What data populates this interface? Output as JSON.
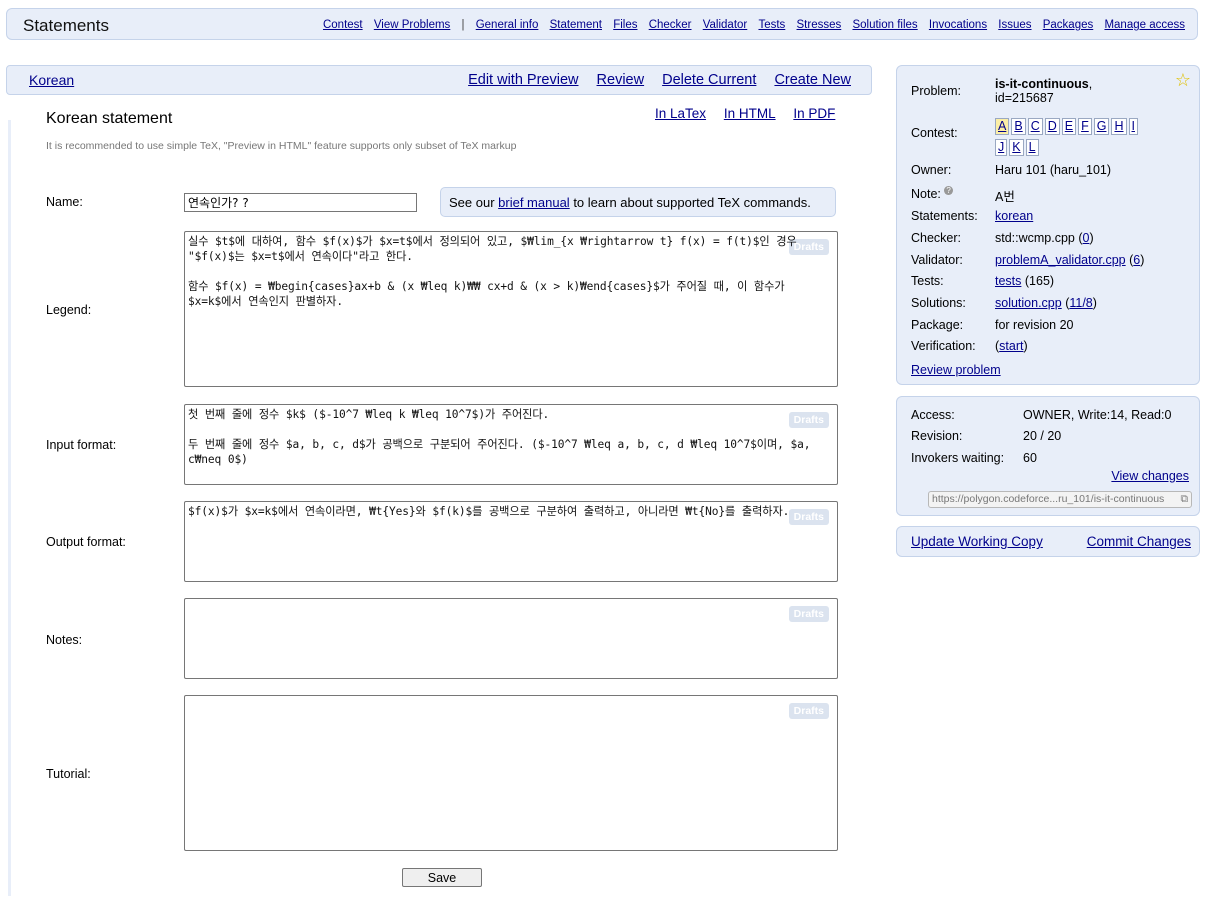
{
  "header": {
    "title": "Statements",
    "menu_left": [
      "Contest",
      "View Problems"
    ],
    "menu_sep": "|",
    "menu_right": [
      "General info",
      "Statement",
      "Files",
      "Checker",
      "Validator",
      "Tests",
      "Stresses",
      "Solution files",
      "Invocations",
      "Issues",
      "Packages",
      "Manage access"
    ]
  },
  "subbar": {
    "language": "Korean",
    "actions": [
      "Edit with Preview",
      "Review",
      "Delete Current",
      "Create New"
    ]
  },
  "statement": {
    "title": "Korean statement",
    "formats": [
      "In LaTex",
      "In HTML",
      "In PDF"
    ],
    "hint": "It is recommended to use simple TeX, \"Preview in HTML\" feature supports only subset of TeX markup",
    "name_label": "Name:",
    "name_value": "연속인가? ?",
    "notice_pre": "See our ",
    "notice_link": "brief manual",
    "notice_post": " to learn about supported TeX commands.",
    "drafts_label": "Drafts",
    "fields": {
      "legend": {
        "label": "Legend:",
        "value": "실수 $t$에 대하여, 함수 $f(x)$가 $x=t$에서 정의되어 있고, $₩lim_{x ₩rightarrow t} f(x) = f(t)$인 경우 \"$f(x)$는 $x=t$에서 연속이다\"라고 한다.\n\n함수 $f(x) = ₩begin{cases}ax+b & (x ₩leq k)₩₩ cx+d & (x > k)₩end{cases}$가 주어질 때, 이 함수가 $x=k$에서 연속인지 판별하자."
      },
      "input": {
        "label": "Input format:",
        "value": "첫 번째 줄에 정수 $k$ ($-10^7 ₩leq k ₩leq 10^7$)가 주어진다.\n\n두 번째 줄에 정수 $a, b, c, d$가 공백으로 구분되어 주어진다. ($-10^7 ₩leq a, b, c, d ₩leq 10^7$이며, $a, c₩neq 0$)"
      },
      "output": {
        "label": "Output format:",
        "value": "$f(x)$가 $x=k$에서 연속이라면, ₩t{Yes}와 $f(k)$를 공백으로 구분하여 출력하고, 아니라면 ₩t{No}를 출력하자."
      },
      "notes": {
        "label": "Notes:",
        "value": ""
      },
      "tutorial": {
        "label": "Tutorial:",
        "value": ""
      }
    },
    "save_label": "Save"
  },
  "problem_info": {
    "problem_label": "Problem:",
    "problem_name": "is-it-continuous",
    "problem_comma": ",",
    "problem_id": "id=215687",
    "contest_label": "Contest:",
    "contest_letters": [
      "A",
      "B",
      "C",
      "D",
      "E",
      "F",
      "G",
      "H",
      "I",
      "J",
      "K",
      "L"
    ],
    "active_letter": "A",
    "owner_label": "Owner:",
    "owner_value": "Haru 101 (haru_101)",
    "note_label": "Note:",
    "note_help": "?",
    "note_value": "A번",
    "statements_label": "Statements:",
    "statements_value": "korean",
    "checker_label": "Checker:",
    "checker_value": "std::wcmp.cpp",
    "checker_count": "0",
    "validator_label": "Validator:",
    "validator_value": "problemA_validator.cpp",
    "validator_count": "6",
    "tests_label": "Tests:",
    "tests_value": "tests",
    "tests_count": "165",
    "solutions_label": "Solutions:",
    "solutions_value": "solution.cpp",
    "solutions_count": "11/8",
    "package_label": "Package:",
    "package_value": "for revision 20",
    "verification_label": "Verification:",
    "verification_value": "start",
    "review_link": "Review problem",
    "star_icon": "star-icon"
  },
  "access_info": {
    "access_label": "Access:",
    "access_value": "OWNER, Write:14, Read:0",
    "revision_label": "Revision:",
    "revision_value": "20 / 20",
    "invokers_label": "Invokers waiting:",
    "invokers_value": "60",
    "view_changes": "View changes",
    "url_value": "https://polygon.codeforce...ru_101/is-it-continuous"
  },
  "working_copy": {
    "update": "Update Working Copy",
    "commit": "Commit Changes"
  }
}
